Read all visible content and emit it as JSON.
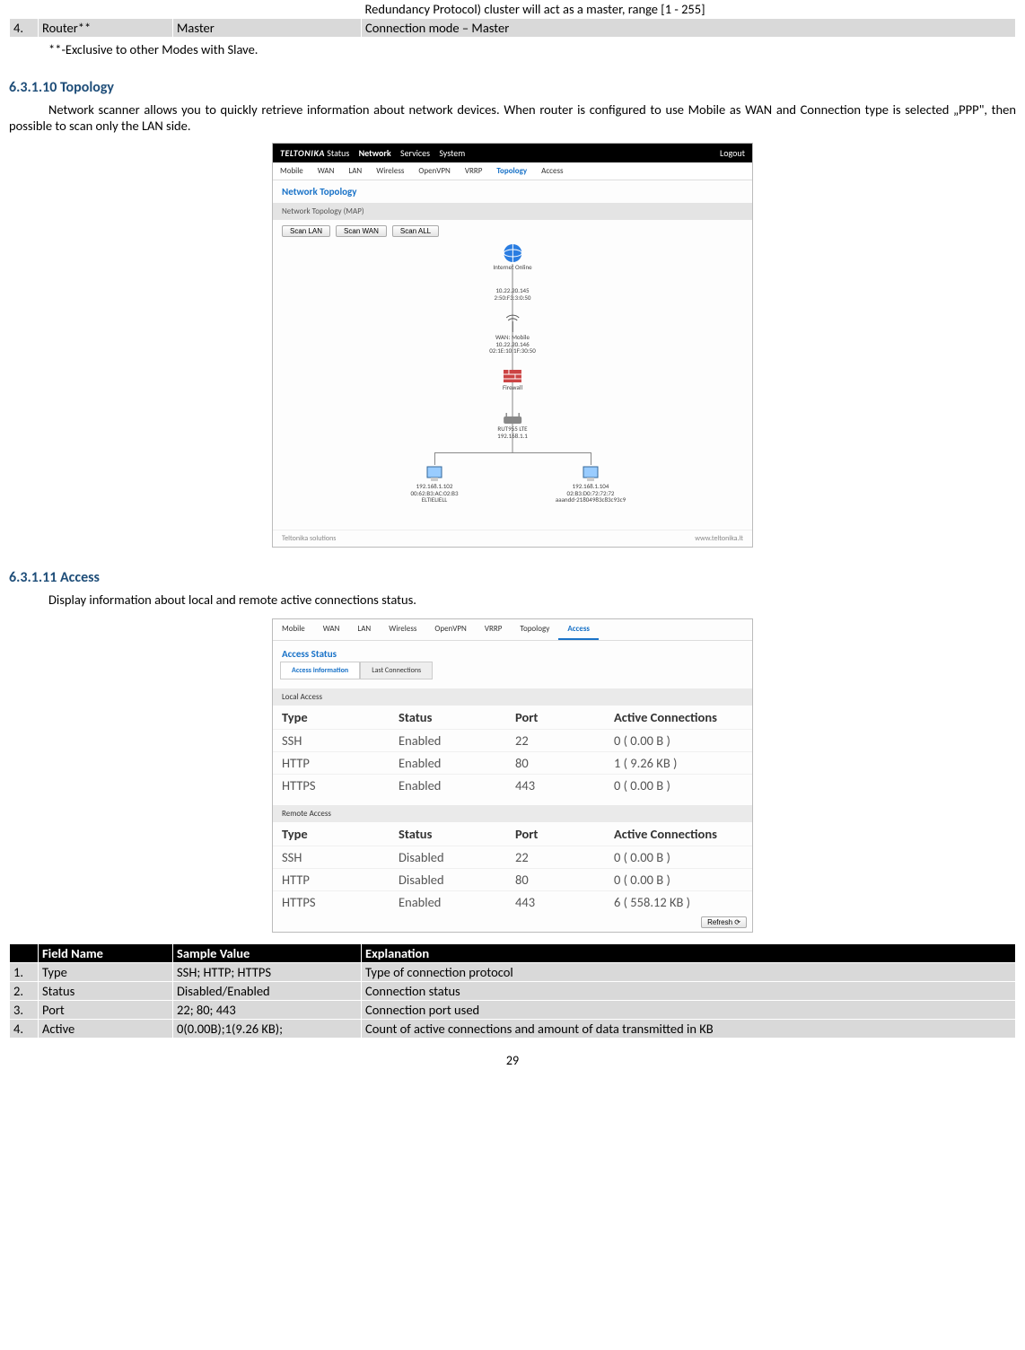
{
  "topTable": {
    "prevExplanation": "Redundancy Protocol) cluster will act as a master, range [1 - 255]",
    "row4": {
      "num": "4.",
      "field": "Router**",
      "sample": "Master",
      "explanation": "Connection mode – Master"
    }
  },
  "footnote": "**-Exclusive to other Modes with Slave.",
  "section1": {
    "heading": "6.3.1.10 Topology",
    "para": "Network scanner allows you to quickly retrieve information about network devices. When router is configured to use Mobile as WAN and Connection type is selected „PPP\", then possible to scan only the LAN side."
  },
  "screenshot1": {
    "brand": "TELTONIKA",
    "nav": [
      "Status",
      "Network",
      "Services",
      "System"
    ],
    "logout": "Logout",
    "tabs": [
      "Mobile",
      "WAN",
      "LAN",
      "Wireless",
      "OpenVPN",
      "VRRP",
      "Topology",
      "Access"
    ],
    "activeTab": "Topology",
    "title": "Network Topology",
    "subtitle": "Network Topology (MAP)",
    "buttons": [
      "Scan LAN",
      "Scan WAN",
      "Scan ALL"
    ],
    "nodes": {
      "internet": "Internet Online",
      "isp": "10.22.20.145\n2:50:F3:3:0:50",
      "wan": "WAN: Mobile\n10.22.20.146\n02:1E:10:1F:30:50",
      "firewall": "Firewall",
      "router": "RUT955 LTE\n192.168.1.1",
      "client1": "192.168.1.102\n00:62:B3:AC:02:B3\nELTIELIELL",
      "client2": "192.168.1.104\n02:B3:D0:72:72:72\naaandd-21804983c83c93c9"
    },
    "footerLeft": "Teltonika solutions",
    "footerRight": "www.teltonika.lt"
  },
  "section2": {
    "heading": "6.3.1.11 Access",
    "para": "Display information about local and remote active connections status."
  },
  "screenshot2": {
    "tabs": [
      "Mobile",
      "WAN",
      "LAN",
      "Wireless",
      "OpenVPN",
      "VRRP",
      "Topology",
      "Access"
    ],
    "activeTab": "Access",
    "title": "Access Status",
    "subtabs": [
      "Access information",
      "Last Connections"
    ],
    "activeSubtab": "Access information",
    "localTitle": "Local Access",
    "remoteTitle": "Remote Access",
    "headers": [
      "Type",
      "Status",
      "Port",
      "Active Connections"
    ],
    "local": [
      {
        "type": "SSH",
        "status": "Enabled",
        "port": "22",
        "active": "0 ( 0.00 B )"
      },
      {
        "type": "HTTP",
        "status": "Enabled",
        "port": "80",
        "active": "1 ( 9.26 KB )"
      },
      {
        "type": "HTTPS",
        "status": "Enabled",
        "port": "443",
        "active": "0 ( 0.00 B )"
      }
    ],
    "remote": [
      {
        "type": "SSH",
        "status": "Disabled",
        "port": "22",
        "active": "0 ( 0.00 B )"
      },
      {
        "type": "HTTP",
        "status": "Disabled",
        "port": "80",
        "active": "0 ( 0.00 B )"
      },
      {
        "type": "HTTPS",
        "status": "Enabled",
        "port": "443",
        "active": "6 ( 558.12 KB )"
      }
    ],
    "refresh": "Refresh ⟳"
  },
  "bottomTable": {
    "headers": [
      "",
      "Field Name",
      "Sample Value",
      "Explanation"
    ],
    "rows": [
      {
        "n": "1.",
        "f": "Type",
        "s": "SSH; HTTP; HTTPS",
        "e": "Type of connection protocol"
      },
      {
        "n": "2.",
        "f": "Status",
        "s": "Disabled/Enabled",
        "e": "Connection status"
      },
      {
        "n": "3.",
        "f": "Port",
        "s": "22; 80; 443",
        "e": "Connection port used"
      },
      {
        "n": "4.",
        "f": "Active",
        "s": "0(0.00B);1(9.26 KB);",
        "e": "Count of active connections and amount of data transmitted in KB"
      }
    ]
  },
  "pageNumber": "29"
}
